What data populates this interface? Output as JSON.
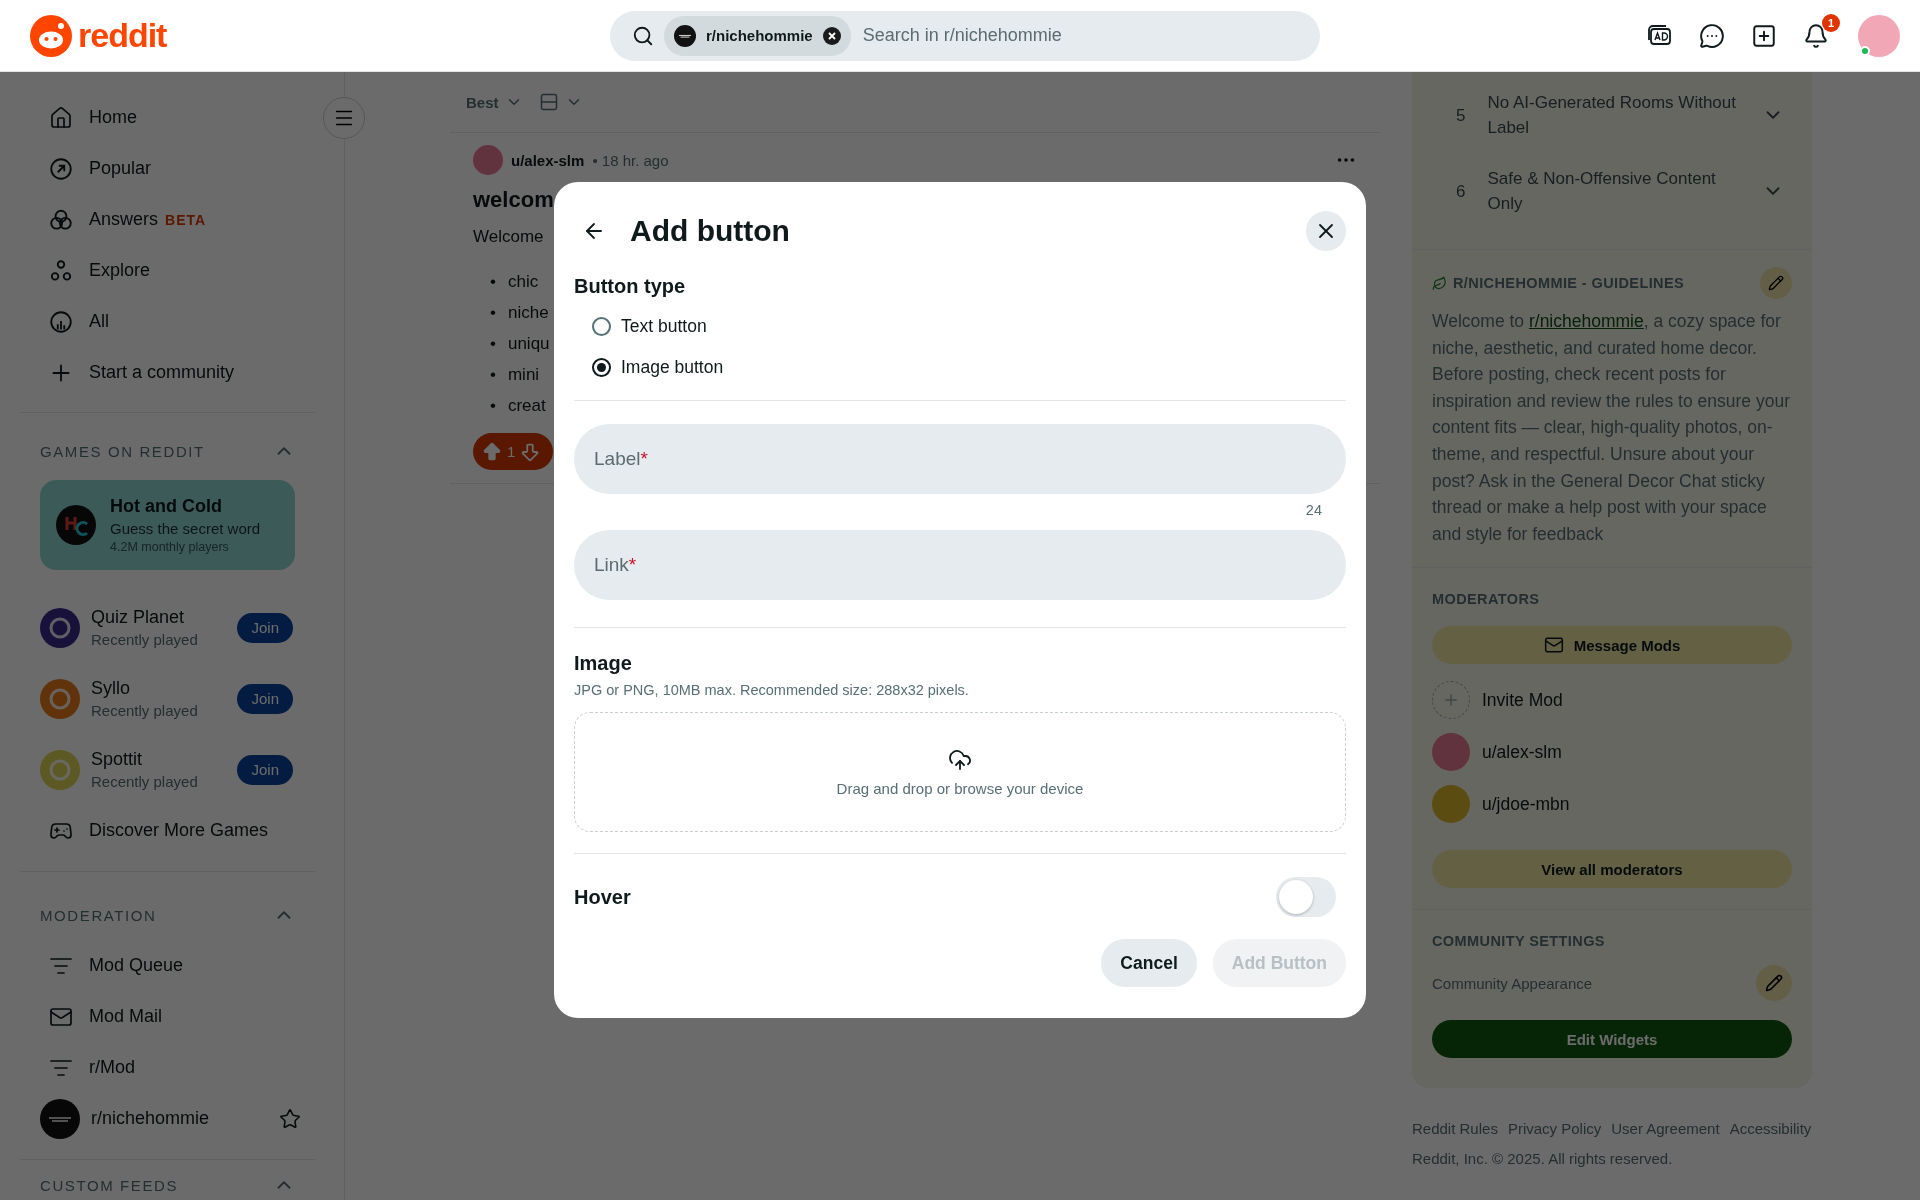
{
  "header": {
    "logo_text": "reddit",
    "search": {
      "community_chip": "r/nichehommie",
      "placeholder": "Search in r/nichehommie"
    },
    "notification_count": "1"
  },
  "sidebar": {
    "nav": [
      {
        "label": "Home",
        "kind": "home"
      },
      {
        "label": "Popular",
        "kind": "popular"
      },
      {
        "label": "Answers",
        "kind": "answers",
        "badge": "BETA"
      },
      {
        "label": "Explore",
        "kind": "explore"
      },
      {
        "label": "All",
        "kind": "all"
      },
      {
        "label": "Start a community",
        "kind": "create"
      }
    ],
    "games": {
      "title": "GAMES ON REDDIT",
      "expanded": true,
      "featured": {
        "name": "Hot and Cold",
        "tagline": "Guess the secret word",
        "players": "4.2M monthly players"
      },
      "items": [
        {
          "name": "Quiz Planet",
          "status": "Recently played",
          "action": "Join"
        },
        {
          "name": "Syllo",
          "status": "Recently played",
          "action": "Join"
        },
        {
          "name": "Spottit",
          "status": "Recently played",
          "action": "Join"
        }
      ],
      "discover": "Discover More Games"
    },
    "moderation": {
      "title": "MODERATION",
      "expanded": true,
      "items": [
        {
          "label": "Mod Queue",
          "kind": "queue"
        },
        {
          "label": "Mod Mail",
          "kind": "mail"
        },
        {
          "label": "r/Mod",
          "kind": "queue"
        },
        {
          "label": "r/nichehommie",
          "kind": "community",
          "starred": false
        }
      ]
    },
    "custom_feeds": {
      "title": "CUSTOM FEEDS",
      "expanded": true
    }
  },
  "feed": {
    "sort": "Best",
    "post": {
      "author": "u/alex-slm",
      "meta": "• 18 hr. ago",
      "title": "welcom",
      "intro": "Welcome",
      "bullet_marker": "•",
      "bullets": [
        "chic",
        "niche",
        "uniqu",
        "mini",
        "creat"
      ],
      "score": "1",
      "upvoted": true
    }
  },
  "right_sidebar": {
    "rules": [
      {
        "number": "5",
        "text": "No AI-Generated Rooms Without Label",
        "expanded": false
      },
      {
        "number": "6",
        "text": "Safe & Non-Offensive Content Only",
        "expanded": false
      }
    ],
    "guidelines": {
      "title": "R/NICHEHOMMIE - GUIDELINES",
      "before": "Welcome to ",
      "link": "r/nichehommie",
      "after": ", a cozy space for niche, aesthetic, and curated home decor. Before posting, check recent posts for inspiration and review the rules to ensure your content fits — clear, high-quality photos, on-theme, and respectful. Unsure about your post? Ask in the General Decor Chat sticky thread or make a help post with your space and style for feedback"
    },
    "moderators": {
      "title": "MODERATORS",
      "message_button": "Message Mods",
      "invite": "Invite Mod",
      "mods": [
        {
          "name": "u/alex-slm"
        },
        {
          "name": "u/jdoe-mbn"
        }
      ],
      "view_all": "View all moderators"
    },
    "settings": {
      "title": "COMMUNITY SETTINGS",
      "appearance": "Community Appearance",
      "edit_widgets": "Edit Widgets"
    },
    "footer": {
      "links": [
        "Reddit Rules",
        "Privacy Policy",
        "User Agreement",
        "Accessibility"
      ],
      "copyright": "Reddit, Inc. © 2025. All rights reserved."
    }
  },
  "modal": {
    "title": "Add button",
    "button_type": {
      "heading": "Button type",
      "options": [
        {
          "label": "Text button",
          "selected": false
        },
        {
          "label": "Image button",
          "selected": true
        }
      ]
    },
    "fields": [
      {
        "label": "Label",
        "required_mark": "*",
        "counter": "24"
      },
      {
        "label": "Link",
        "required_mark": "*"
      }
    ],
    "image": {
      "heading": "Image",
      "hint": "JPG or PNG, 10MB max. Recommended size: 288x32 pixels.",
      "dropzone": "Drag and drop or browse your device"
    },
    "hover": {
      "label": "Hover",
      "on": false
    },
    "actions": [
      {
        "label": "Cancel",
        "kind": "secondary",
        "disabled": false
      },
      {
        "label": "Add Button",
        "kind": "primary",
        "disabled": true
      }
    ]
  }
}
